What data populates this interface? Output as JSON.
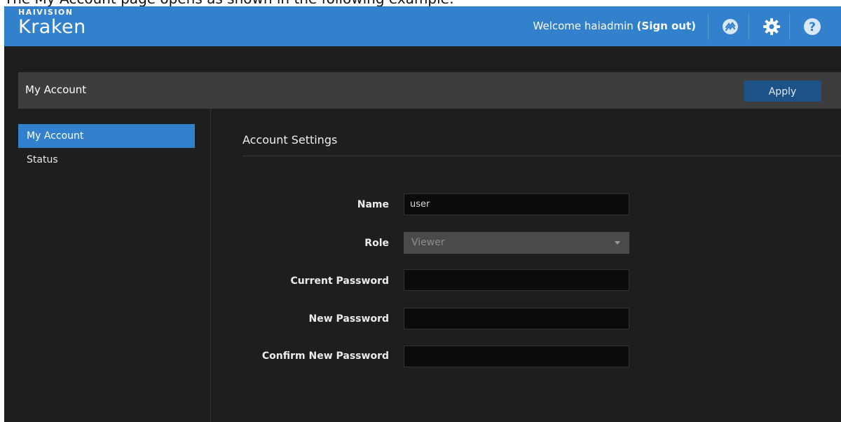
{
  "caption": "The My Account page opens as shown in the following example:",
  "brand": {
    "company": "HAIVISION",
    "product": "Kraken"
  },
  "header": {
    "welcome_text": "Welcome haiadmin",
    "sign_out": "(Sign out)",
    "icons": [
      "haivision-logo-icon",
      "gear-icon",
      "help-icon"
    ]
  },
  "page": {
    "title": "My Account",
    "apply_label": "Apply"
  },
  "sidebar": {
    "items": [
      {
        "label": "My Account",
        "active": true
      },
      {
        "label": "Status",
        "active": false
      }
    ]
  },
  "form": {
    "section_title": "Account Settings",
    "name_label": "Name",
    "name_value": "user",
    "role_label": "Role",
    "role_value": "Viewer",
    "current_password_label": "Current Password",
    "new_password_label": "New Password",
    "confirm_password_label": "Confirm New Password"
  },
  "colors": {
    "topbar": "#3380cc",
    "background": "#1e1e1e",
    "header_bar": "#3d3d3d",
    "apply_button": "#1c5287",
    "active_nav": "#3380cc"
  }
}
